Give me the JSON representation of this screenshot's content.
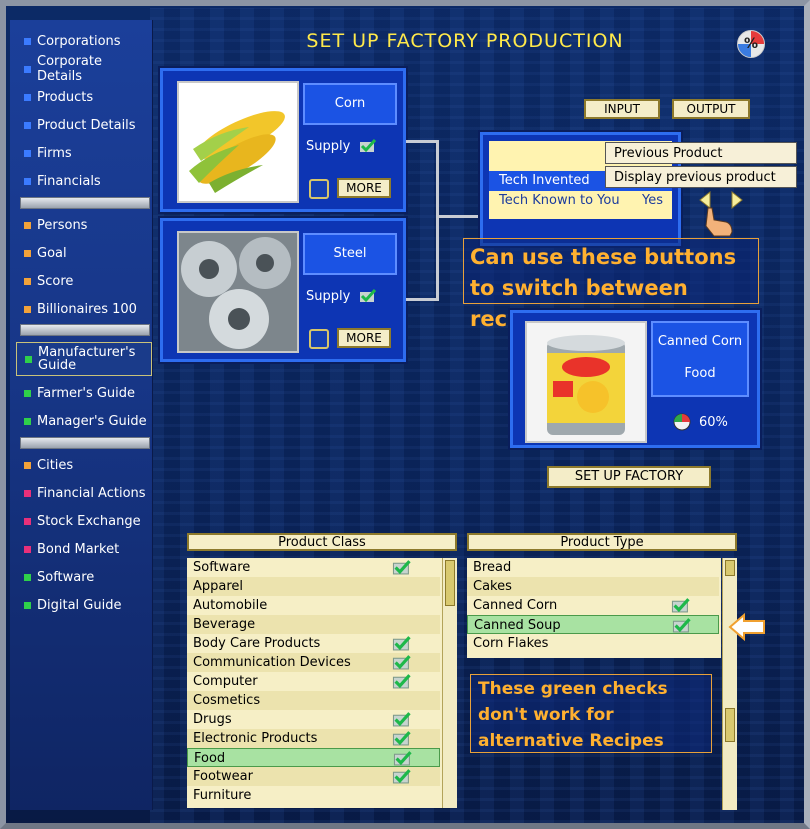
{
  "sidebar": {
    "items": [
      {
        "label": "Corporations",
        "color": "#3b7bff"
      },
      {
        "label": "Corporate Details",
        "color": "#3b7bff"
      },
      {
        "label": "Products",
        "color": "#3b7bff"
      },
      {
        "label": "Product Details",
        "color": "#3b7bff"
      },
      {
        "label": "Firms",
        "color": "#3b7bff"
      },
      {
        "label": "Financials",
        "color": "#3b7bff"
      },
      {
        "label": "Persons",
        "color": "#f2a23a"
      },
      {
        "label": "Goal",
        "color": "#f2a23a"
      },
      {
        "label": "Score",
        "color": "#f2a23a"
      },
      {
        "label": "Billionaires 100",
        "color": "#f2a23a"
      },
      {
        "label": "Manufacturer's Guide",
        "color": "#2fd04a"
      },
      {
        "label": "Farmer's Guide",
        "color": "#2fd04a"
      },
      {
        "label": "Manager's Guide",
        "color": "#2fd04a"
      },
      {
        "label": "Cities",
        "color": "#f2a23a"
      },
      {
        "label": "Financial Actions",
        "color": "#e8307a"
      },
      {
        "label": "Stock Exchange",
        "color": "#e8307a"
      },
      {
        "label": "Bond Market",
        "color": "#e8307a"
      },
      {
        "label": "Software",
        "color": "#2fd04a"
      },
      {
        "label": "Digital Guide",
        "color": "#2fd04a"
      }
    ]
  },
  "title": "SET UP FACTORY PRODUCTION",
  "percent_icon": "%",
  "inputs": [
    {
      "name": "Corn",
      "supply_label": "Supply",
      "more_label": "MORE"
    },
    {
      "name": "Steel",
      "supply_label": "Supply",
      "more_label": "MORE"
    }
  ],
  "io_buttons": {
    "input": "INPUT",
    "output": "OUTPUT"
  },
  "tech": {
    "invented_label": "Tech Invented",
    "known_label": "Tech Known to You",
    "known_value": "Yes"
  },
  "tooltip": {
    "line1": "Previous Product",
    "line2": "Display previous product"
  },
  "callout_recipes": "Can use these buttons to switch between recipes",
  "output": {
    "name": "Canned Corn",
    "category": "Food",
    "percent": "60%"
  },
  "setup_button": "SET UP FACTORY",
  "product_class": {
    "header": "Product Class",
    "items": [
      {
        "label": "Software",
        "check": true
      },
      {
        "label": "Apparel",
        "check": false
      },
      {
        "label": "Automobile",
        "check": false
      },
      {
        "label": "Beverage",
        "check": false
      },
      {
        "label": "Body Care Products",
        "check": true
      },
      {
        "label": "Communication Devices",
        "check": true
      },
      {
        "label": "Computer",
        "check": true
      },
      {
        "label": "Cosmetics",
        "check": false
      },
      {
        "label": "Drugs",
        "check": true
      },
      {
        "label": "Electronic Products",
        "check": true
      },
      {
        "label": "Food",
        "check": true,
        "selected": true
      },
      {
        "label": "Footwear",
        "check": true
      },
      {
        "label": "Furniture",
        "check": false
      }
    ]
  },
  "product_type": {
    "header": "Product Type",
    "items": [
      {
        "label": "Bread",
        "check": false
      },
      {
        "label": "Cakes",
        "check": false
      },
      {
        "label": "Canned Corn",
        "check": true
      },
      {
        "label": "Canned Soup",
        "check": true,
        "selected": true
      },
      {
        "label": "Corn Flakes",
        "check": false
      }
    ]
  },
  "callout_checks": "These green checks don't work for alternative Recipes"
}
